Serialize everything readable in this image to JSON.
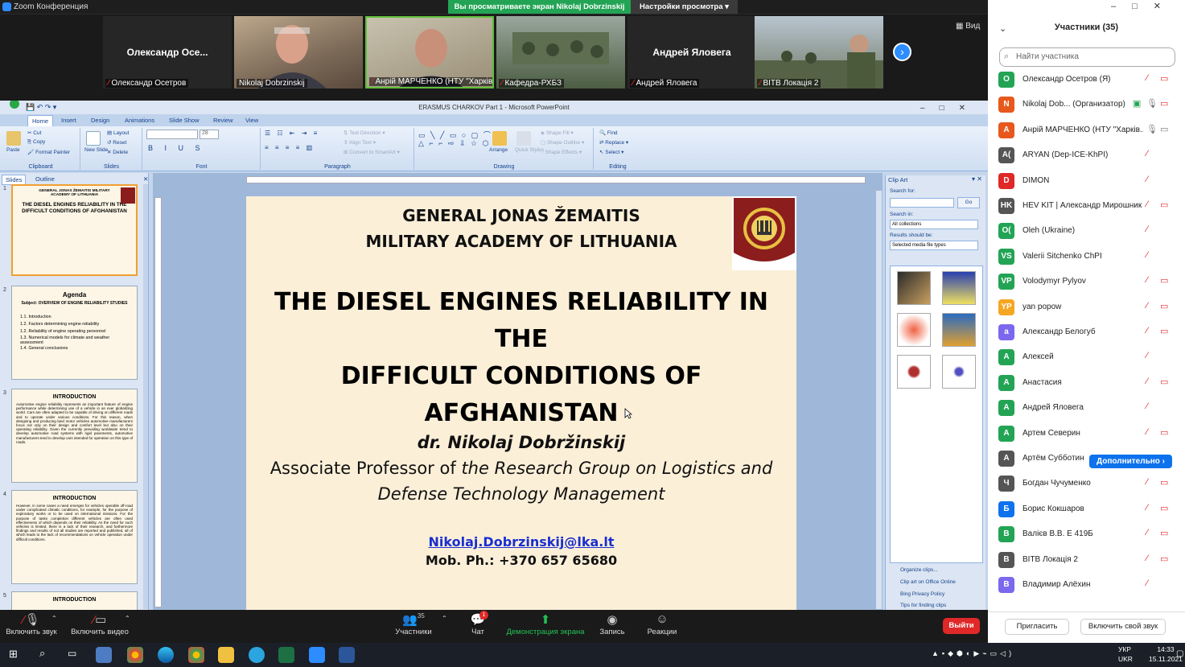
{
  "zoom": {
    "window_title": "Zoom Конференция",
    "banner": "Вы просматриваете экран Nikolaj Dobrzinskij",
    "view_settings": "Настройки просмотра",
    "view_button": "Вид",
    "tiles": [
      {
        "big_name": "Олександр  Осе...",
        "label": "Олександр Осетров"
      },
      {
        "big_name": "",
        "label": "Nikolaj Dobrzinskij"
      },
      {
        "big_name": "",
        "label": "Анрій МАРЧЕНКО (НТУ \"Харківс..."
      },
      {
        "big_name": "",
        "label": "Кафедра-РХБЗ"
      },
      {
        "big_name": "Андрей Яловега",
        "label": "Андрей Яловега"
      },
      {
        "big_name": "",
        "label": "ВІТВ Локація 2"
      }
    ],
    "toolbar": {
      "mute": "Включить звук",
      "video": "Включить видео",
      "participants": "Участники",
      "participants_count": "35",
      "chat": "Чат",
      "chat_badge": "1",
      "share": "Демонстрация экрана",
      "record": "Запись",
      "reactions": "Реакции",
      "end": "Выйти"
    }
  },
  "ppt": {
    "title": "ERASMUS CHARKOV Part 1 - Microsoft PowerPoint",
    "tabs": [
      "Home",
      "Insert",
      "Design",
      "Animations",
      "Slide Show",
      "Review",
      "View"
    ],
    "ribbon": {
      "paste": "Paste",
      "cut": "Cut",
      "copy": "Copy",
      "format_painter": "Format Painter",
      "clipboard": "Clipboard",
      "new_slide": "New Slide",
      "layout": "Layout",
      "reset": "Reset",
      "delete": "Delete",
      "slides": "Slides",
      "font": "Font",
      "font_size": "28",
      "paragraph": "Paragraph",
      "text_direction": "Text Direction",
      "align_text": "Align Text",
      "convert_smartart": "Convert to SmartArt",
      "drawing": "Drawing",
      "arrange": "Arrange",
      "quick_styles": "Quick Styles",
      "shape_fill": "Shape Fill",
      "shape_outline": "Shape Outline",
      "shape_effects": "Shape Effects",
      "find": "Find",
      "replace": "Replace",
      "select": "Select",
      "editing": "Editing"
    },
    "panel_tabs": [
      "Slides",
      "Outline"
    ],
    "thumbs": [
      {
        "num": "1",
        "title": "GENERAL JONAS ŽEMAITIS MILITARY ACADEMY OF LITHUANIA",
        "subtitle": "THE DIESEL ENGINES RELIABILITY IN THE DIFFICULT CONDITIONS OF AFGHANISTAN"
      },
      {
        "num": "2",
        "title": "Agenda",
        "subtitle": "Subject: OVERVIEW OF ENGINE RELIABILITY STUDIES",
        "items": [
          "1.1. Introduction",
          "1.2. Factors determining engine reliability",
          "1.2. Reliability of engine operating personnel",
          "1.3. Numerical models for climate and weather assessment",
          "1.4. General conclusions"
        ]
      },
      {
        "num": "3",
        "title": "INTRODUCTION",
        "body": "Automotive engine reliability represents an important feature of engine performance while determining use of a vehicle in an ever globalizing world. Cars are often adapted to be capable of driving on different roads and to operate under various conditions. For this reason, when designing and producing land motor vehicles automotive manufacturers focus not only on their design and comfort level but also on their operating reliability. Given the currently prevailing worldwide trend to develop automotive road systems with rigid pavements, automotive manufacturers tend to develop cars intended for operation on this type of roads."
      },
      {
        "num": "4",
        "title": "INTRODUCTION",
        "body": "However, in some cases a need emerges for vehicles operable off-road under complicated climatic conditions, for example, for the purpose of exploratory works or to be used on international missions. For the purpose of tasks completion different vehicles are often used effectiveness of which depends on their reliability. As the need for such vehicles is limited, there is a lack of their research, and furthermore findings and results of not all studies are reported and published, all of which leads to the lack of recommendations on vehicle operation under difficult conditions."
      },
      {
        "num": "5",
        "title": "INTRODUCTION"
      }
    ],
    "slide": {
      "inst_line1": "GENERAL JONAS ŽEMAITIS",
      "inst_line2": "MILITARY ACADEMY OF LITHUANIA",
      "title_line1": "THE DIESEL ENGINES RELIABILITY IN THE",
      "title_line2": "DIFFICULT CONDITIONS OF AFGHANISTAN",
      "author": "dr. Nikolaj Dobržinskij",
      "position_prefix": "Associate Professor of ",
      "position_group": "the Research Group on Logistics and",
      "position_line2": "Defense Technology Management",
      "email": "Nikolaj.Dobrzinskij@lka.lt",
      "phone": "Mob. Ph.: +370 657 65680"
    },
    "clipart": {
      "title": "Clip Art",
      "search_for": "Search for:",
      "go": "Go",
      "search_in": "Search in:",
      "search_in_value": "All collections",
      "results": "Results should be:",
      "results_value": "Selected media file types",
      "links": [
        "Organize clips...",
        "Clip art on Office Online",
        "Bing Privacy Policy",
        "Tips for finding clips"
      ]
    }
  },
  "participants": {
    "title": "Участники (35)",
    "search_placeholder": "Найти участника",
    "more_button": "Дополнительно ›",
    "invite": "Пригласить",
    "unmute_me": "Включить свой звук",
    "list": [
      {
        "initials": "О",
        "color": "#23a455",
        "name": "Олександр Осетров (Я)"
      },
      {
        "initials": "N",
        "color": "#e8581c",
        "name": "Nikolaj Dob... (Организатор)"
      },
      {
        "initials": "А",
        "color": "#e8581c",
        "name": "Анрій МАРЧЕНКО (НТУ \"Харків..."
      },
      {
        "initials": "A(",
        "color": "#555555",
        "name": "ARYAN (Dep-ICE-KhPI)"
      },
      {
        "initials": "D",
        "color": "#e02828",
        "name": "DIMON"
      },
      {
        "initials": "HK",
        "color": "#555555",
        "name": "HEV KIT | Александр Мирошник"
      },
      {
        "initials": "O(",
        "color": "#23a455",
        "name": "Oleh (Ukraine)"
      },
      {
        "initials": "VS",
        "color": "#23a455",
        "name": "Valerii Sitchenko ChPI"
      },
      {
        "initials": "VP",
        "color": "#23a455",
        "name": "Volodymyr Pylyov"
      },
      {
        "initials": "YP",
        "color": "#f5a623",
        "name": "yan popow"
      },
      {
        "initials": "а",
        "color": "#7b68ee",
        "name": "Александр Белогуб"
      },
      {
        "initials": "А",
        "color": "#23a455",
        "name": "Алексей"
      },
      {
        "initials": "А",
        "color": "#23a455",
        "name": "Анастасия"
      },
      {
        "initials": "А",
        "color": "#23a455",
        "name": "Андрей Яловега"
      },
      {
        "initials": "А",
        "color": "#23a455",
        "name": "Артем Север́ин"
      },
      {
        "initials": "А",
        "color": "#555555",
        "name": "Артём Субботин"
      },
      {
        "initials": "Ч",
        "color": "#555555",
        "name": "Богдан Чучуменко"
      },
      {
        "initials": "Б",
        "color": "#0e72ed",
        "name": "Борис Кокшаров"
      },
      {
        "initials": "В",
        "color": "#23a455",
        "name": "Валієв В.В. Е 419Б"
      },
      {
        "initials": "В",
        "color": "#555555",
        "name": "ВІТВ Локація 2"
      },
      {
        "initials": "В",
        "color": "#7b68ee",
        "name": "Владимир Алёхин"
      }
    ]
  },
  "taskbar": {
    "lang": "УКР",
    "lang2": "UKR",
    "time": "14:33",
    "date": "15.11.2021"
  }
}
